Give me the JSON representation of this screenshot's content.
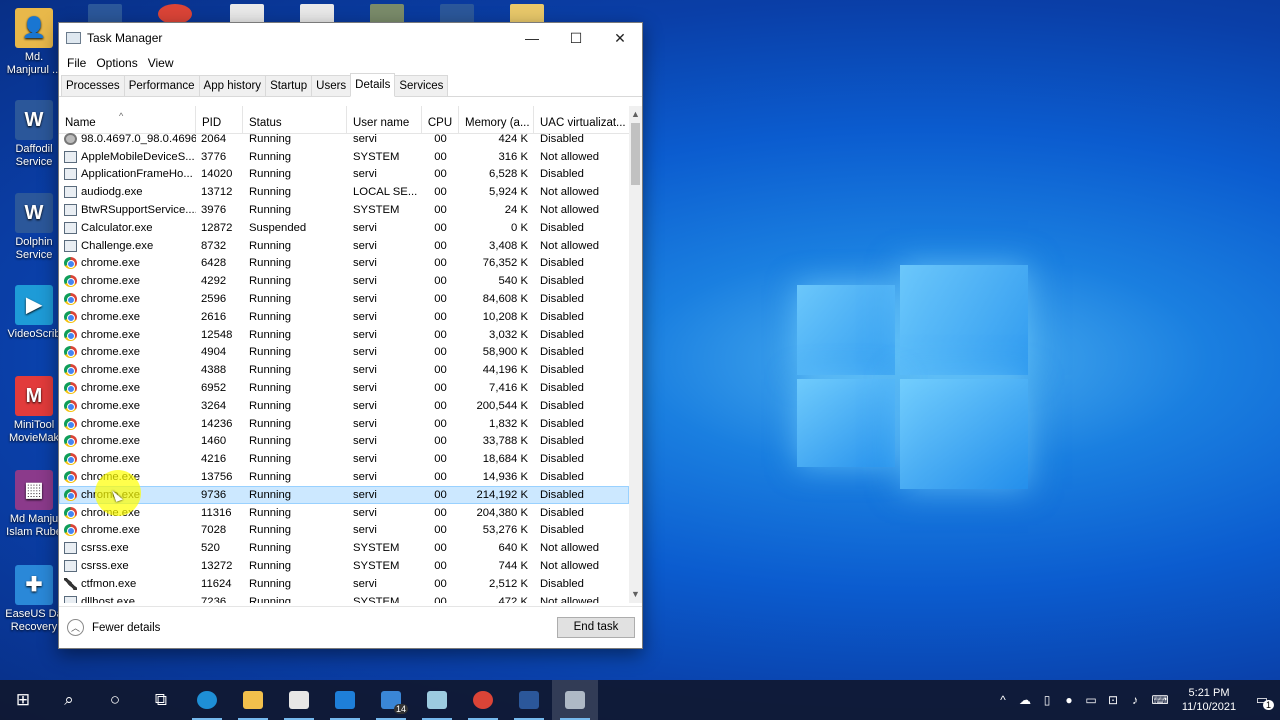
{
  "window": {
    "title": "Task Manager",
    "minimize": "—",
    "maximize": "☐",
    "close": "✕"
  },
  "menu": [
    "File",
    "Options",
    "View"
  ],
  "tabs": [
    "Processes",
    "Performance",
    "App history",
    "Startup",
    "Users",
    "Details",
    "Services"
  ],
  "active_tab": "Details",
  "columns": {
    "name": "Name",
    "pid": "PID",
    "status": "Status",
    "user": "User name",
    "cpu": "CPU",
    "memory": "Memory (a...",
    "uac": "UAC virtualizat..."
  },
  "processes": [
    {
      "name": "98.0.4697.0_98.0.4696...",
      "pid": "2064",
      "status": "Running",
      "user": "servi",
      "cpu": "00",
      "mem": "424 K",
      "uac": "Disabled",
      "icon": "gear"
    },
    {
      "name": "AppleMobileDeviceS...",
      "pid": "3776",
      "status": "Running",
      "user": "SYSTEM",
      "cpu": "00",
      "mem": "316 K",
      "uac": "Not allowed",
      "icon": "app"
    },
    {
      "name": "ApplicationFrameHo...",
      "pid": "14020",
      "status": "Running",
      "user": "servi",
      "cpu": "00",
      "mem": "6,528 K",
      "uac": "Disabled",
      "icon": "app"
    },
    {
      "name": "audiodg.exe",
      "pid": "13712",
      "status": "Running",
      "user": "LOCAL SE...",
      "cpu": "00",
      "mem": "5,924 K",
      "uac": "Not allowed",
      "icon": "app"
    },
    {
      "name": "BtwRSupportService....",
      "pid": "3976",
      "status": "Running",
      "user": "SYSTEM",
      "cpu": "00",
      "mem": "24 K",
      "uac": "Not allowed",
      "icon": "app"
    },
    {
      "name": "Calculator.exe",
      "pid": "12872",
      "status": "Suspended",
      "user": "servi",
      "cpu": "00",
      "mem": "0 K",
      "uac": "Disabled",
      "icon": "app"
    },
    {
      "name": "Challenge.exe",
      "pid": "8732",
      "status": "Running",
      "user": "servi",
      "cpu": "00",
      "mem": "3,408 K",
      "uac": "Not allowed",
      "icon": "app"
    },
    {
      "name": "chrome.exe",
      "pid": "6428",
      "status": "Running",
      "user": "servi",
      "cpu": "00",
      "mem": "76,352 K",
      "uac": "Disabled",
      "icon": "chrome"
    },
    {
      "name": "chrome.exe",
      "pid": "4292",
      "status": "Running",
      "user": "servi",
      "cpu": "00",
      "mem": "540 K",
      "uac": "Disabled",
      "icon": "chrome"
    },
    {
      "name": "chrome.exe",
      "pid": "2596",
      "status": "Running",
      "user": "servi",
      "cpu": "00",
      "mem": "84,608 K",
      "uac": "Disabled",
      "icon": "chrome"
    },
    {
      "name": "chrome.exe",
      "pid": "2616",
      "status": "Running",
      "user": "servi",
      "cpu": "00",
      "mem": "10,208 K",
      "uac": "Disabled",
      "icon": "chrome"
    },
    {
      "name": "chrome.exe",
      "pid": "12548",
      "status": "Running",
      "user": "servi",
      "cpu": "00",
      "mem": "3,032 K",
      "uac": "Disabled",
      "icon": "chrome"
    },
    {
      "name": "chrome.exe",
      "pid": "4904",
      "status": "Running",
      "user": "servi",
      "cpu": "00",
      "mem": "58,900 K",
      "uac": "Disabled",
      "icon": "chrome"
    },
    {
      "name": "chrome.exe",
      "pid": "4388",
      "status": "Running",
      "user": "servi",
      "cpu": "00",
      "mem": "44,196 K",
      "uac": "Disabled",
      "icon": "chrome"
    },
    {
      "name": "chrome.exe",
      "pid": "6952",
      "status": "Running",
      "user": "servi",
      "cpu": "00",
      "mem": "7,416 K",
      "uac": "Disabled",
      "icon": "chrome"
    },
    {
      "name": "chrome.exe",
      "pid": "3264",
      "status": "Running",
      "user": "servi",
      "cpu": "00",
      "mem": "200,544 K",
      "uac": "Disabled",
      "icon": "chrome"
    },
    {
      "name": "chrome.exe",
      "pid": "14236",
      "status": "Running",
      "user": "servi",
      "cpu": "00",
      "mem": "1,832 K",
      "uac": "Disabled",
      "icon": "chrome"
    },
    {
      "name": "chrome.exe",
      "pid": "1460",
      "status": "Running",
      "user": "servi",
      "cpu": "00",
      "mem": "33,788 K",
      "uac": "Disabled",
      "icon": "chrome"
    },
    {
      "name": "chrome.exe",
      "pid": "4216",
      "status": "Running",
      "user": "servi",
      "cpu": "00",
      "mem": "18,684 K",
      "uac": "Disabled",
      "icon": "chrome"
    },
    {
      "name": "chrome.exe",
      "pid": "13756",
      "status": "Running",
      "user": "servi",
      "cpu": "00",
      "mem": "14,936 K",
      "uac": "Disabled",
      "icon": "chrome"
    },
    {
      "name": "chrome.exe",
      "pid": "9736",
      "status": "Running",
      "user": "servi",
      "cpu": "00",
      "mem": "214,192 K",
      "uac": "Disabled",
      "icon": "chrome",
      "selected": true
    },
    {
      "name": "chrome.exe",
      "pid": "11316",
      "status": "Running",
      "user": "servi",
      "cpu": "00",
      "mem": "204,380 K",
      "uac": "Disabled",
      "icon": "chrome"
    },
    {
      "name": "chrome.exe",
      "pid": "7028",
      "status": "Running",
      "user": "servi",
      "cpu": "00",
      "mem": "53,276 K",
      "uac": "Disabled",
      "icon": "chrome"
    },
    {
      "name": "csrss.exe",
      "pid": "520",
      "status": "Running",
      "user": "SYSTEM",
      "cpu": "00",
      "mem": "640 K",
      "uac": "Not allowed",
      "icon": "app"
    },
    {
      "name": "csrss.exe",
      "pid": "13272",
      "status": "Running",
      "user": "SYSTEM",
      "cpu": "00",
      "mem": "744 K",
      "uac": "Not allowed",
      "icon": "app"
    },
    {
      "name": "ctfmon.exe",
      "pid": "11624",
      "status": "Running",
      "user": "servi",
      "cpu": "00",
      "mem": "2,512 K",
      "uac": "Disabled",
      "icon": "pen"
    },
    {
      "name": "dllhost.exe",
      "pid": "7236",
      "status": "Running",
      "user": "SYSTEM",
      "cpu": "00",
      "mem": "472 K",
      "uac": "Not allowed",
      "icon": "app"
    }
  ],
  "footer": {
    "fewer_details": "Fewer details",
    "end_task": "End task"
  },
  "desktop_icons": [
    {
      "label": "Md. Manjurul ...",
      "color": "#e8b84a",
      "glyph": "👤"
    },
    {
      "label": "Daffodil Service",
      "color": "#2b579a",
      "glyph": "W"
    },
    {
      "label": "Dolphin Service",
      "color": "#2b579a",
      "glyph": "W"
    },
    {
      "label": "VideoScrib",
      "color": "#1e9bd7",
      "glyph": "▶"
    },
    {
      "label": "MiniTool MovieMak",
      "color": "#e23b3b",
      "glyph": "M"
    },
    {
      "label": "Md Manju Islam Rube",
      "color": "#8b3a8b",
      "glyph": "▦"
    },
    {
      "label": "EaseUS Da Recovery",
      "color": "#2a88d8",
      "glyph": "✚"
    }
  ],
  "taskbar": {
    "apps": [
      {
        "name": "start",
        "glyph": "⊞"
      },
      {
        "name": "search",
        "glyph": "⌕"
      },
      {
        "name": "cortana",
        "glyph": "○"
      },
      {
        "name": "task-view",
        "glyph": "⧉"
      },
      {
        "name": "edge",
        "color": "#1e8fd6"
      },
      {
        "name": "file-explorer",
        "color": "#f2c04c"
      },
      {
        "name": "store",
        "color": "#e6e6e6"
      },
      {
        "name": "mail",
        "color": "#1e7fd9"
      },
      {
        "name": "calendar-app",
        "color": "#3a86d6",
        "badge": "14"
      },
      {
        "name": "sticky-app",
        "color": "#9ccbe0"
      },
      {
        "name": "chrome",
        "color": "#db4437"
      },
      {
        "name": "word",
        "color": "#2b579a"
      },
      {
        "name": "task-manager",
        "color": "#aeb9c6"
      }
    ],
    "time": "5:21 PM",
    "date": "11/10/2021",
    "notification_count": "1"
  }
}
